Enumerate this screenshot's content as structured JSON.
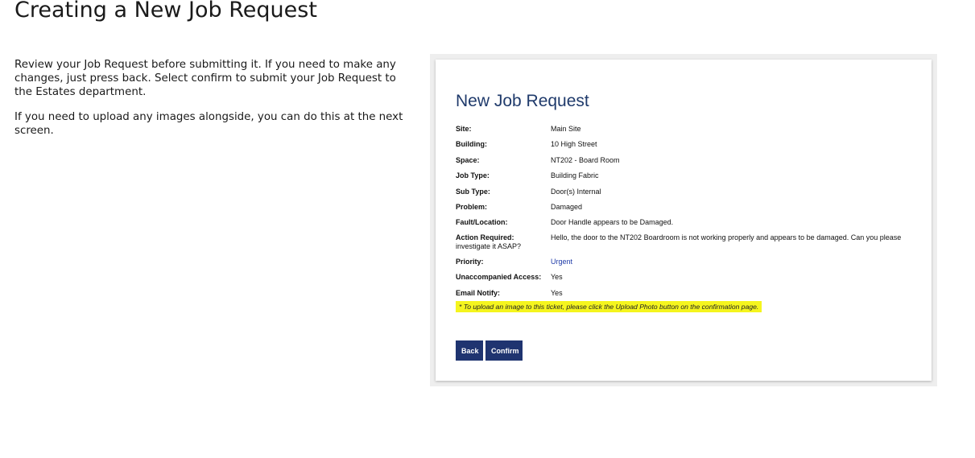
{
  "page": {
    "title": "Creating a New Job Request",
    "intro_paragraphs": [
      "Review your Job Request before submitting it. If you need to make any changes, just press back. Select confirm to submit your Job Request to the Estates department.",
      "If you need to upload any images alongside, you can do this at the next screen."
    ]
  },
  "form": {
    "title": "New Job Request",
    "fields": [
      {
        "label": "Site:",
        "value": "Main Site"
      },
      {
        "label": "Building:",
        "value": "10 High Street"
      },
      {
        "label": "Space:",
        "value": "NT202 - Board Room"
      },
      {
        "label": "Job Type:",
        "value": "Building Fabric"
      },
      {
        "label": "Sub Type:",
        "value": "Door(s) Internal"
      },
      {
        "label": "Problem:",
        "value": "Damaged"
      },
      {
        "label": "Fault/Location:",
        "value": "Door Handle appears to be Damaged."
      },
      {
        "label": "Action Required:",
        "value": "Hello, the door to the NT202 Boardroom is not working properly and appears to be damaged. Can you please investigate it ASAP?"
      },
      {
        "label": "Priority:",
        "value": "Urgent"
      },
      {
        "label": "Unaccompanied Access:",
        "value": "Yes"
      },
      {
        "label": "Email Notify:",
        "value": "Yes"
      }
    ],
    "note": "* To upload an image to this ticket, please click the Upload Photo button on the confirmation page.",
    "back_label": "Back",
    "confirm_label": "Confirm"
  },
  "colors": {
    "title_blue": "#1f3a6b",
    "button_navy": "#1f3470",
    "priority_blue": "#1e3aa8",
    "note_highlight": "#f5f51e"
  }
}
